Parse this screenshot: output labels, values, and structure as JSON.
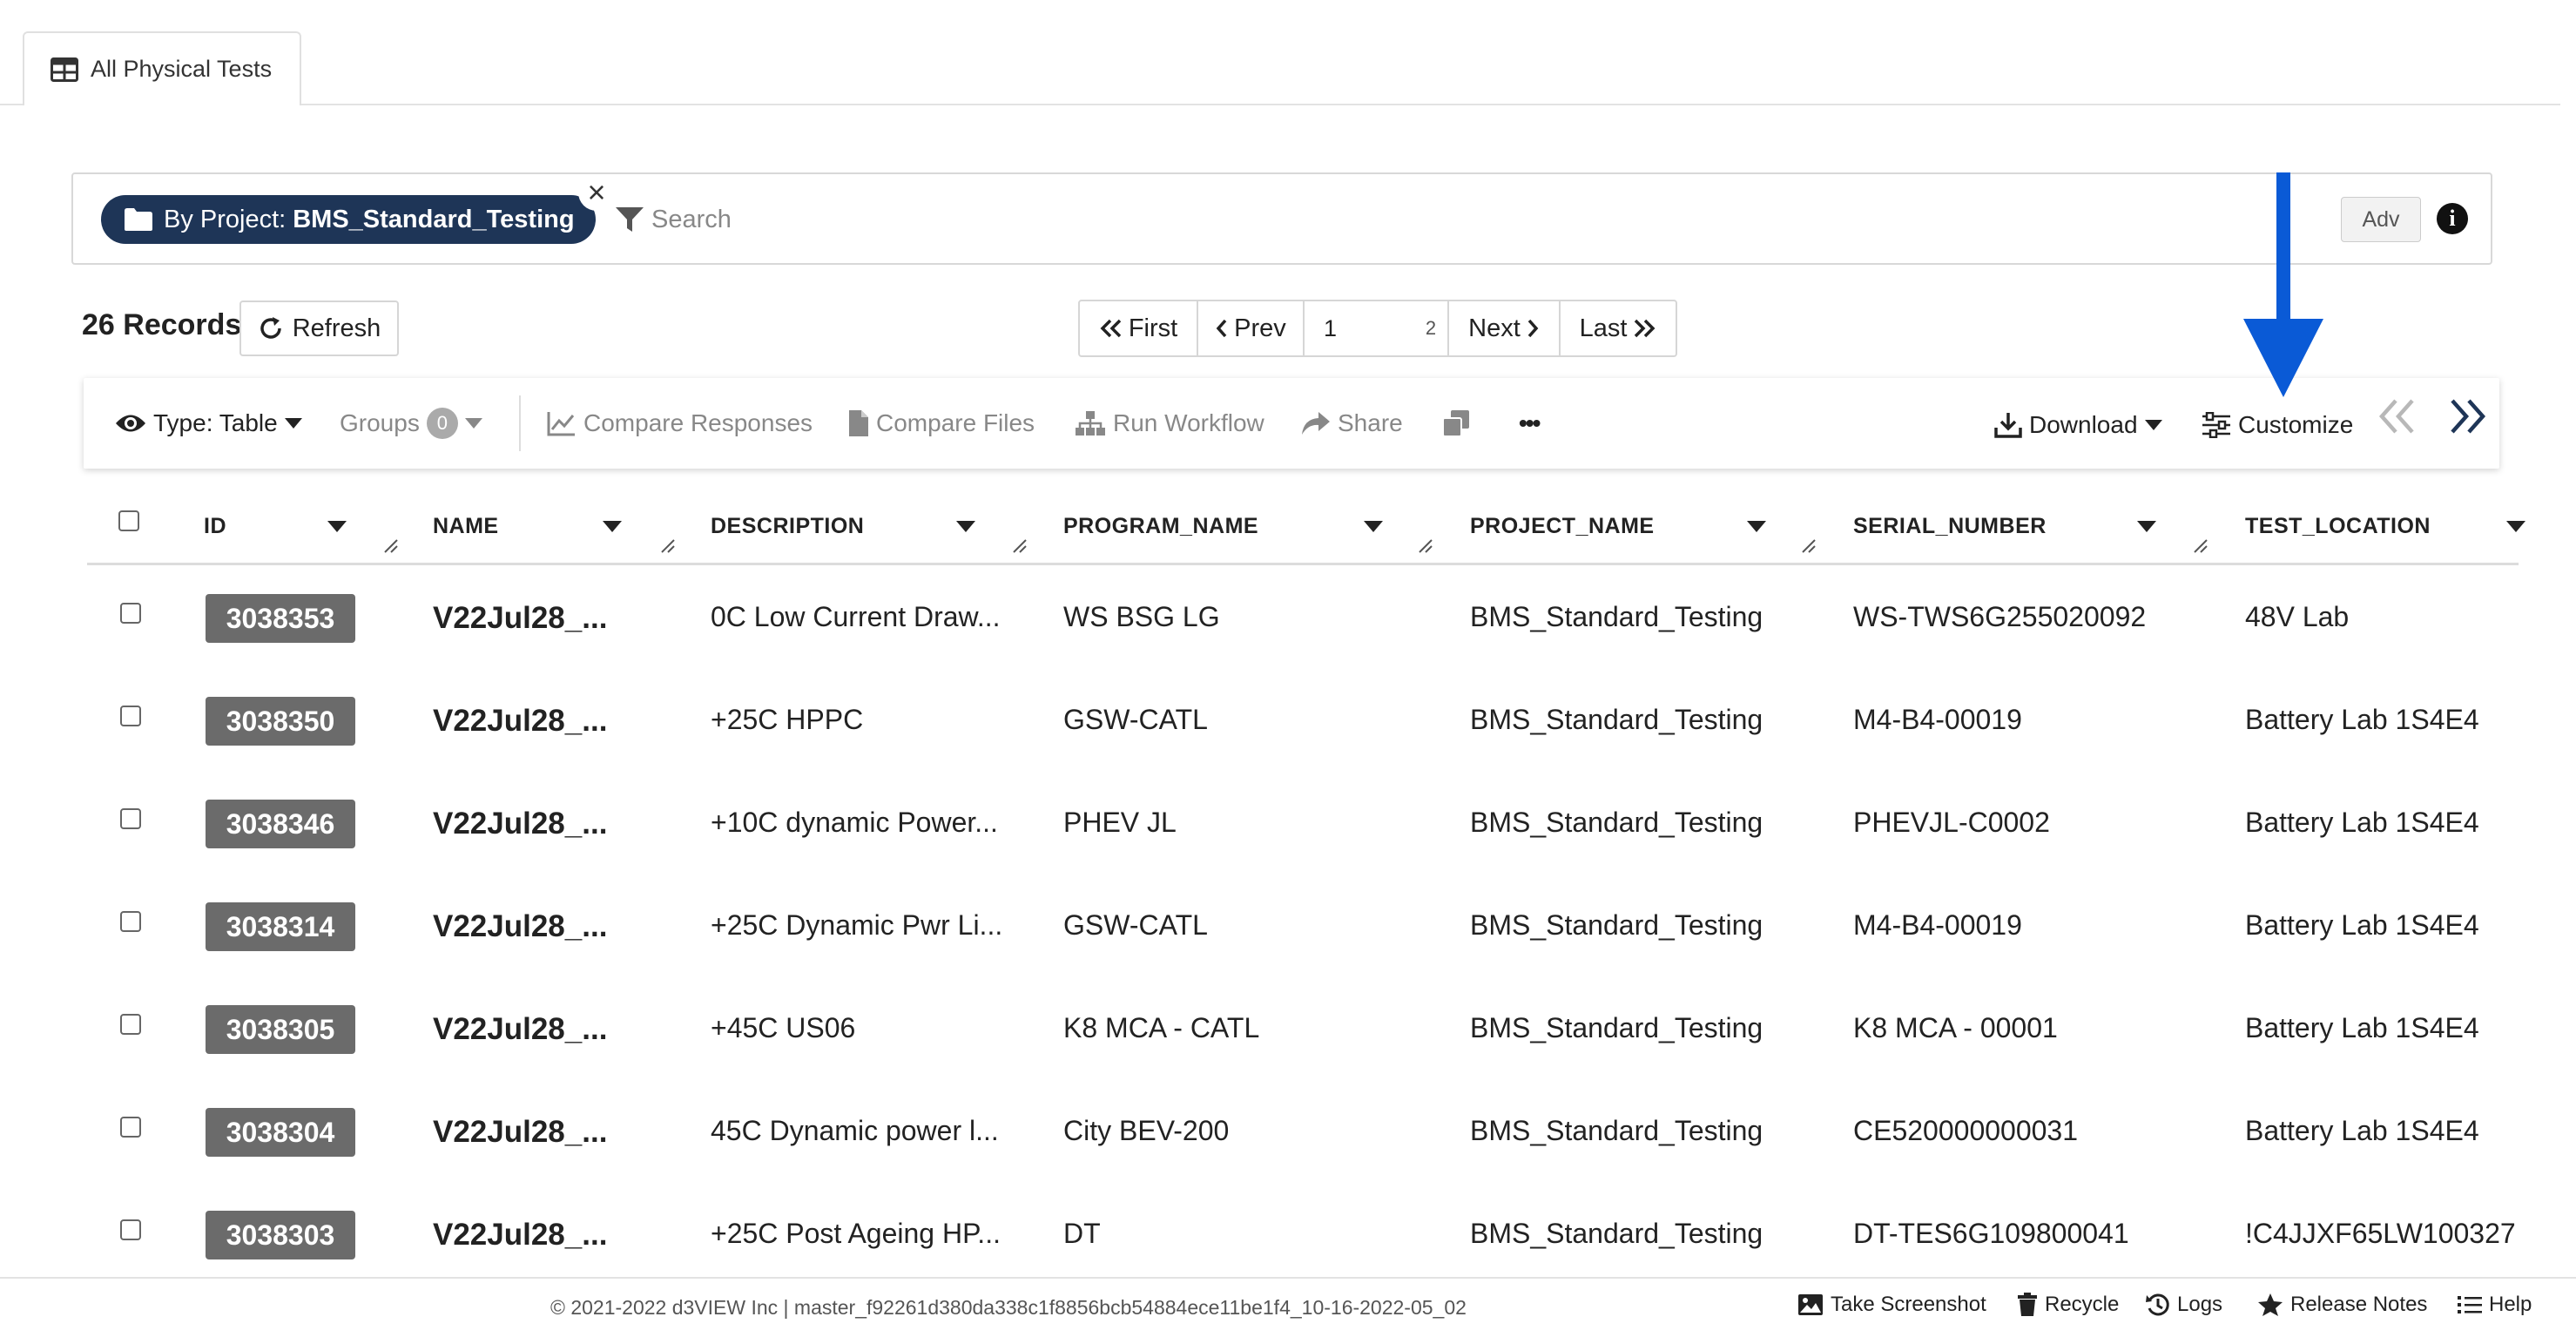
{
  "tab": {
    "label": "All Physical Tests",
    "icon": "table-icon"
  },
  "filter_chip": {
    "prefix": "By Project:",
    "value": "BMS_Standard_Testing",
    "icon": "folder-icon"
  },
  "search": {
    "placeholder": "Search",
    "adv_label": "Adv"
  },
  "records": {
    "count_label": "26 Records",
    "refresh_label": "Refresh"
  },
  "pagination": {
    "first": "First",
    "prev": "Prev",
    "current": "1",
    "total": "2",
    "next": "Next",
    "last": "Last"
  },
  "toolbar": {
    "type_label": "Type: Table",
    "groups_label": "Groups",
    "groups_count": "0",
    "compare_responses": "Compare Responses",
    "compare_files": "Compare Files",
    "run_workflow": "Run Workflow",
    "share": "Share",
    "more": "•••",
    "download": "Download",
    "customize": "Customize"
  },
  "table": {
    "columns": [
      "ID",
      "NAME",
      "DESCRIPTION",
      "PROGRAM_NAME",
      "PROJECT_NAME",
      "SERIAL_NUMBER",
      "TEST_LOCATION"
    ],
    "rows": [
      {
        "id": "3038353",
        "name": "V22Jul28_...",
        "description": "0C Low Current Draw...",
        "program": "WS BSG LG",
        "project": "BMS_Standard_Testing",
        "serial": "WS-TWS6G255020092",
        "location": "48V Lab"
      },
      {
        "id": "3038350",
        "name": "V22Jul28_...",
        "description": "+25C HPPC",
        "program": "GSW-CATL",
        "project": "BMS_Standard_Testing",
        "serial": "M4-B4-00019",
        "location": "Battery Lab 1S4E4"
      },
      {
        "id": "3038346",
        "name": "V22Jul28_...",
        "description": "+10C dynamic Power...",
        "program": "PHEV JL",
        "project": "BMS_Standard_Testing",
        "serial": "PHEVJL-C0002",
        "location": "Battery Lab 1S4E4"
      },
      {
        "id": "3038314",
        "name": "V22Jul28_...",
        "description": "+25C Dynamic Pwr Li...",
        "program": "GSW-CATL",
        "project": "BMS_Standard_Testing",
        "serial": "M4-B4-00019",
        "location": "Battery Lab 1S4E4"
      },
      {
        "id": "3038305",
        "name": "V22Jul28_...",
        "description": "+45C US06",
        "program": "K8 MCA - CATL",
        "project": "BMS_Standard_Testing",
        "serial": "K8 MCA - 00001",
        "location": "Battery Lab 1S4E4"
      },
      {
        "id": "3038304",
        "name": "V22Jul28_...",
        "description": "45C Dynamic power l...",
        "program": "City BEV-200",
        "project": "BMS_Standard_Testing",
        "serial": "CE520000000031",
        "location": "Battery Lab 1S4E4"
      },
      {
        "id": "3038303",
        "name": "V22Jul28_...",
        "description": "+25C Post Ageing HP...",
        "program": "DT",
        "project": "BMS_Standard_Testing",
        "serial": "DT-TES6G109800041",
        "location": "!C4JJXF65LW100327"
      }
    ]
  },
  "footer": {
    "copyright": "© 2021-2022 d3VIEW Inc | master_f92261d380da338c1f8856bcb54884ece11be1f4_10-16-2022-05_02",
    "take_screenshot": "Take Screenshot",
    "recycle": "Recycle",
    "logs": "Logs",
    "release_notes": "Release Notes",
    "help": "Help"
  },
  "colors": {
    "chip_bg": "#1e3557",
    "id_badge": "#6b6b6b",
    "annotation_arrow": "#0a5ad6"
  }
}
